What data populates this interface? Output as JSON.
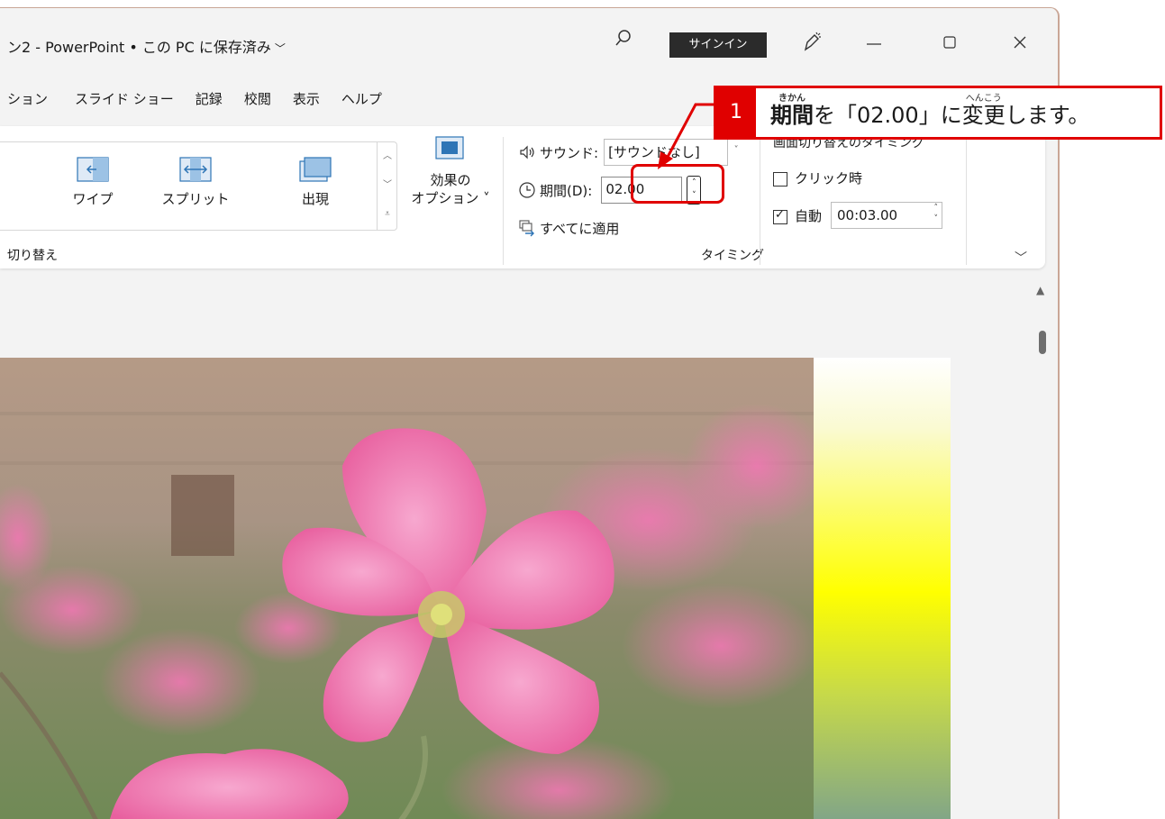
{
  "titlebar": {
    "title": "ン2 - PowerPoint • この PC に保存済み",
    "signin_label": "サインイン"
  },
  "tabs": [
    "ション",
    "スライド ショー",
    "記録",
    "校閲",
    "表示",
    "ヘルプ"
  ],
  "transitions": {
    "items": [
      {
        "label": "ワイプ"
      },
      {
        "label": "スプリット"
      },
      {
        "label": "出現"
      }
    ],
    "effect_options": {
      "line1": "効果の",
      "line2": "オプション ˅"
    },
    "group_label": "切り替え"
  },
  "timing": {
    "sound_label": "サウンド:",
    "sound_value": "[サウンドなし]",
    "period_label": "期間(D):",
    "period_value": "02.00",
    "apply_all_label": "すべてに適用",
    "group_label": "タイミング"
  },
  "advance": {
    "title": "画面切り替えのタイミング",
    "on_click_label": "クリック時",
    "on_click_checked": false,
    "auto_label": "自動",
    "auto_checked": true,
    "auto_time": "00:03.00"
  },
  "callout": {
    "number": "1",
    "ruby_period": "きかん",
    "word_period": "期間",
    "text_mid": "を「02.00」に",
    "ruby_change": "へんこう",
    "word_change": "変更",
    "text_end": "します。"
  },
  "colors": {
    "accent": "#e00000",
    "signin_bg": "#2b2b2b",
    "transition_icon": "#2e75b6"
  }
}
